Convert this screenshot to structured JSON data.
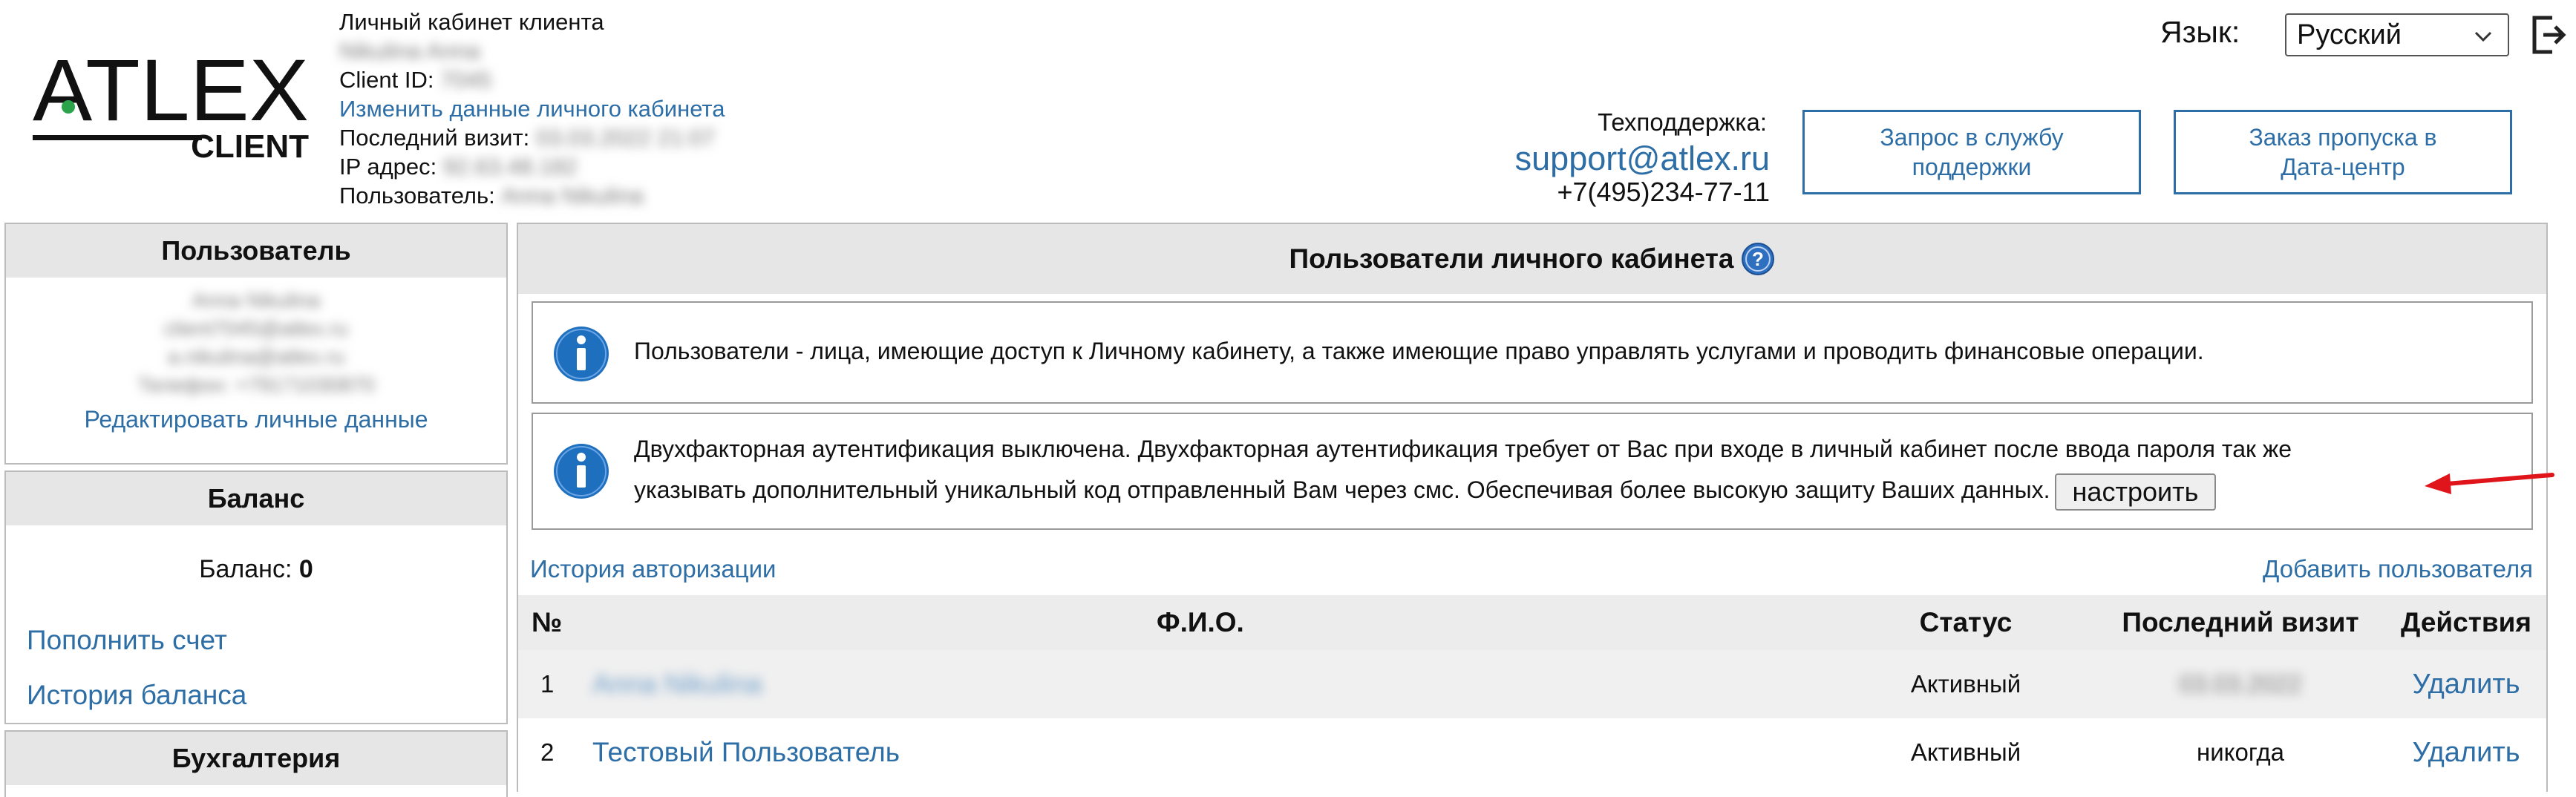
{
  "header": {
    "logo_text": "ATLEX",
    "logo_sub": "CLIENT",
    "cabinet_title": "Личный кабинет клиента",
    "client_name": "Nikulina Anna",
    "client_id_label": "Client ID:",
    "client_id_value": "7045",
    "edit_cabinet_link": "Изменить данные личного кабинета",
    "last_visit_label": "Последний визит:",
    "last_visit_value": "03.03.2022 21:07",
    "ip_label": "IP адрес:",
    "ip_value": "92.63.48.182",
    "user_label": "Пользователь:",
    "user_value": "Anna Nikulina",
    "support_label": "Техподдержка:",
    "support_email": "support@atlex.ru",
    "support_phone": "+7(495)234-77-11",
    "support_request_button": "Запрос в службу поддержки",
    "pass_order_button": "Заказ пропуска в Дата-центр",
    "language_label": "Язык:",
    "language_selected": "Русский"
  },
  "sidebar": {
    "user_panel": {
      "title": "Пользователь",
      "name": "Anna Nikulina",
      "email1": "client7045@atlex.ru",
      "email2": "a.nikulina@atlex.ru",
      "phone": "Телефон: +79171030870",
      "edit_link": "Редактировать личные данные"
    },
    "balance_panel": {
      "title": "Баланс",
      "balance_label": "Баланс:",
      "balance_value": "0",
      "topup_link": "Пополнить счет",
      "history_link": "История баланса"
    },
    "accounting_panel": {
      "title": "Бухгалтерия"
    }
  },
  "main": {
    "title": "Пользователи личного кабинета",
    "info_users": "Пользователи - лица, имеющие доступ к Личному кабинету, а также имеющие право управлять услугами и проводить финансовые операции.",
    "info_2fa_line1": "Двухфакторная аутентификация выключена. Двухфакторная аутентификация требует от Вас при входе в личный кабинет после ввода пароля так же",
    "info_2fa_line2": "указывать дополнительный уникальный код отправленный Вам через смс. Обеспечивая более высокую защиту Ваших данных.",
    "setup_button": "настроить",
    "auth_history_link": "История авторизации",
    "add_user_link": "Добавить пользователя",
    "table": {
      "columns": [
        "№",
        "Ф.И.О.",
        "Статус",
        "Последний визит",
        "Действия"
      ],
      "rows": [
        {
          "num": "1",
          "name": "Anna Nikulina",
          "status": "Активный",
          "last_visit": "03.03.2022",
          "action": "Удалить"
        },
        {
          "num": "2",
          "name": "Тестовый Пользователь",
          "status": "Активный",
          "last_visit": "никогда",
          "action": "Удалить"
        }
      ]
    }
  },
  "colors": {
    "link": "#2e6ea6",
    "header_bg": "#e6e6e6",
    "info_icon": "#1f6fbf",
    "arrow": "#e0151b"
  }
}
